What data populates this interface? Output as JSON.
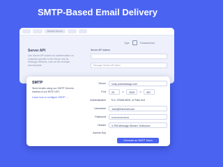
{
  "title": "SMTP-Based Email Delivery",
  "bg_window": {
    "top_cells": [
      "",
      "",
      "Default Server",
      "",
      ""
    ],
    "tab_label": "Type",
    "tab_value": "Transactional",
    "left_heading": "Server API",
    "left_text": "Use Server API tokens for authentication on endpoints specific to the Server and its Message Streams, such as the example and template.",
    "mid_label": "Server API tokens",
    "mid_input": "",
    "mid_extra": "Message Stream API token"
  },
  "card": {
    "heading": "SMTP",
    "desc": "Send emails using our SMTP Servers instead of our REST API.",
    "link": "Learn how to configure SMTP →",
    "server_label": "Server",
    "server_value": "smtp.postmarkapp.com",
    "port_label": "Port",
    "port_a": "25",
    "port_b": "2525",
    "port_c": "587",
    "auth_label": "Authentication",
    "auth_value": "TLS, CRAM-MD5, or Plain text",
    "user_label": "Username",
    "user_value": "Jane@fmicenail.com",
    "pass_label": "Password",
    "pass_value": "••••••••••••••••••••",
    "header_label": "Header",
    "header_value": "X-PM-Message-Stream: Outbound",
    "access_label": "Access Key",
    "access_value": "",
    "button": "Generate an SMTP Token"
  },
  "colors": {
    "background": "#4a63f1",
    "accent": "#4a63f1"
  }
}
